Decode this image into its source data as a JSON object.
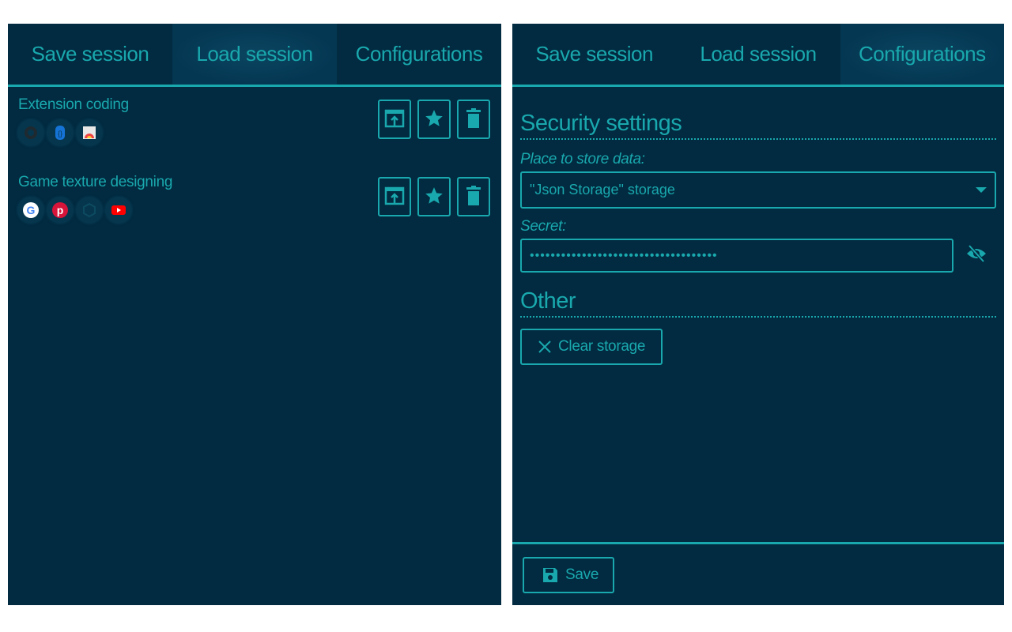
{
  "colors": {
    "accent": "#19a8ad",
    "background": "#022a40",
    "active_tab": "#0b4560"
  },
  "tabs": [
    "Save session",
    "Load session",
    "Configurations"
  ],
  "left": {
    "active_tab": "Load session",
    "sessions": [
      {
        "name": "Extension coding",
        "icons": [
          "github-icon",
          "json-storage-icon",
          "chrome-web-store-icon"
        ]
      },
      {
        "name": "Game texture designing",
        "icons": [
          "google-icon",
          "pinterest-icon",
          "unity-icon",
          "youtube-icon"
        ]
      }
    ],
    "actions": [
      "open-session-icon",
      "star-icon",
      "trash-icon"
    ]
  },
  "right": {
    "active_tab": "Configurations",
    "security_title": "Security settings",
    "store_label": "Place to store data:",
    "store_value": "\"Json Storage\" storage",
    "secret_label": "Secret:",
    "secret_value": "••••••••••••••••••••••••••••••••••••",
    "other_title": "Other",
    "clear_label": "Clear storage",
    "save_label": "Save"
  }
}
